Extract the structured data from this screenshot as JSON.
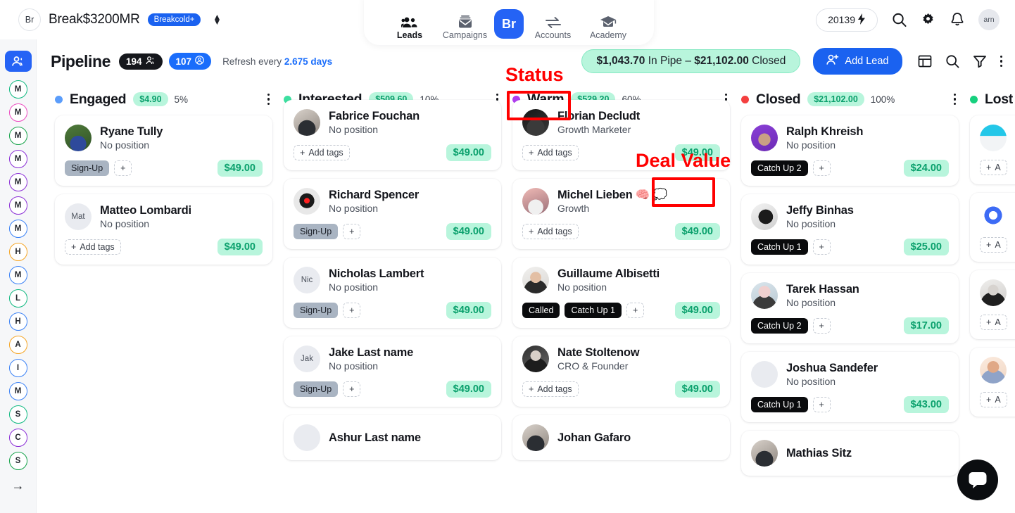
{
  "topbar": {
    "workspace_initials": "Br",
    "workspace_name": "Break$3200MR",
    "plan_badge": "Breakcold+",
    "nav": [
      {
        "label": "Leads",
        "icon": "people-icon",
        "active": true
      },
      {
        "label": "Campaigns",
        "icon": "envelope-icon",
        "active": false
      },
      {
        "label": "",
        "icon": "breakcold-logo",
        "logo_text": "Br",
        "active": false
      },
      {
        "label": "Accounts",
        "icon": "exchange-arrows-icon",
        "active": false
      },
      {
        "label": "Academy",
        "icon": "graduation-cap-icon",
        "active": false
      }
    ],
    "credits": "20139",
    "credits_icon": "lightning-bolt-icon",
    "user_initials": "arn"
  },
  "rail": {
    "top_icon": "people-icon",
    "chips": [
      {
        "letter": "M",
        "color": "#10b981"
      },
      {
        "letter": "M",
        "color": "#ec4bc1"
      },
      {
        "letter": "M",
        "color": "#16a34a"
      },
      {
        "letter": "M",
        "color": "#8b2fd6"
      },
      {
        "letter": "M",
        "color": "#8b2fd6"
      },
      {
        "letter": "M",
        "color": "#8b2fd6"
      },
      {
        "letter": "M",
        "color": "#3b82f6"
      },
      {
        "letter": "H",
        "color": "#f5a524"
      },
      {
        "letter": "M",
        "color": "#3b82f6"
      },
      {
        "letter": "L",
        "color": "#10b981"
      },
      {
        "letter": "H",
        "color": "#3b82f6"
      },
      {
        "letter": "A",
        "color": "#f5a524"
      },
      {
        "letter": "I",
        "color": "#3b82f6"
      },
      {
        "letter": "M",
        "color": "#3b82f6"
      },
      {
        "letter": "S",
        "color": "#10b981"
      },
      {
        "letter": "C",
        "color": "#8b2fd6"
      },
      {
        "letter": "S",
        "color": "#16a34a"
      }
    ],
    "expand_icon": "arrow-right-icon"
  },
  "header": {
    "title": "Pipeline",
    "leads_count": "194",
    "contacts_count": "107",
    "refresh_prefix": "Refresh every",
    "refresh_value": "2.675 days",
    "totals_in_pipe_amount": "$1,043.70",
    "totals_in_pipe_label": "In Pipe",
    "totals_separator": "–",
    "totals_closed_amount": "$21,102.00",
    "totals_closed_label": "Closed",
    "add_lead_label": "Add Lead",
    "icons": [
      "table-view-icon",
      "search-icon",
      "filter-icon",
      "more-options-icon"
    ]
  },
  "annotations": [
    {
      "id": "status-label",
      "text": "Status"
    },
    {
      "id": "deal-value-label",
      "text": "Deal Value"
    }
  ],
  "columns": [
    {
      "name": "Engaged",
      "dot_color": "#5b9dfb",
      "amount": "$4.90",
      "percent": "5%",
      "cards": [
        {
          "name": "Ryane Tully",
          "position": "No position",
          "avatar_initials": "",
          "avatar_kind": "photo-green",
          "tags": [
            {
              "label": "Sign-Up",
              "style": "grey"
            }
          ],
          "add_tag": "+",
          "money": "$49.00"
        },
        {
          "name": "Matteo Lombardi",
          "position": "No position",
          "avatar_initials": "Mat",
          "avatar_kind": "initials",
          "tags": [],
          "add_tag": "Add tags",
          "money": "$49.00"
        }
      ]
    },
    {
      "name": "Interested",
      "dot_color": "#3ddfa0",
      "amount": "$509.60",
      "percent": "10%",
      "cards": [
        {
          "name": "Fabrice Fouchan",
          "position": "No position",
          "avatar_initials": "",
          "avatar_kind": "photo-dark",
          "tags": [],
          "add_tag": "Add tags",
          "money": "$49.00"
        },
        {
          "name": "Richard Spencer",
          "position": "No position",
          "avatar_initials": "",
          "avatar_kind": "photo-hal",
          "tags": [
            {
              "label": "Sign-Up",
              "style": "grey"
            }
          ],
          "add_tag": "+",
          "money": "$49.00"
        },
        {
          "name": "Nicholas Lambert",
          "position": "No position",
          "avatar_initials": "Nic",
          "avatar_kind": "initials",
          "tags": [
            {
              "label": "Sign-Up",
              "style": "grey"
            }
          ],
          "add_tag": "+",
          "money": "$49.00"
        },
        {
          "name": "Jake Last name",
          "position": "No position",
          "avatar_initials": "Jak",
          "avatar_kind": "initials",
          "tags": [
            {
              "label": "Sign-Up",
              "style": "grey"
            }
          ],
          "add_tag": "+",
          "money": "$49.00"
        },
        {
          "name": "Ashur Last name",
          "position": "",
          "avatar_initials": "",
          "avatar_kind": "initials",
          "tags": [],
          "add_tag": "",
          "money": ""
        }
      ]
    },
    {
      "name": "Warm",
      "dot_color": "#b03df0",
      "amount": "$529.20",
      "percent": "60%",
      "highlighted": true,
      "cards": [
        {
          "name": "Florian Decludt",
          "position": "Growth Marketer",
          "avatar_initials": "",
          "avatar_kind": "photo-bw",
          "tags": [],
          "add_tag": "Add tags",
          "money": "$49.00",
          "money_highlighted": true
        },
        {
          "name": "Michel Lieben 🧠 💭",
          "position": "Growth",
          "avatar_initials": "",
          "avatar_kind": "photo-pink",
          "tags": [],
          "add_tag": "Add tags",
          "money": "$49.00"
        },
        {
          "name": "Guillaume Albisetti",
          "position": "No position",
          "avatar_initials": "",
          "avatar_kind": "photo-light",
          "tags": [
            {
              "label": "Called",
              "style": "black"
            },
            {
              "label": "Catch Up 1",
              "style": "black"
            }
          ],
          "add_tag": "+",
          "money": "$49.00"
        },
        {
          "name": "Nate Stoltenow",
          "position": "CRO & Founder",
          "avatar_initials": "",
          "avatar_kind": "photo-bw2",
          "tags": [],
          "add_tag": "Add tags",
          "money": "$49.00"
        },
        {
          "name": "Johan Gafaro",
          "position": "",
          "avatar_initials": "",
          "avatar_kind": "photo-dark",
          "tags": [],
          "add_tag": "",
          "money": ""
        }
      ]
    },
    {
      "name": "Closed",
      "dot_color": "#f43f3f",
      "amount": "$21,102.00",
      "percent": "100%",
      "cards": [
        {
          "name": "Ralph Khreish",
          "position": "No position",
          "avatar_initials": "",
          "avatar_kind": "photo-purple",
          "tags": [
            {
              "label": "Catch Up 2",
              "style": "black"
            }
          ],
          "add_tag": "+",
          "money": "$24.00"
        },
        {
          "name": "Jeffy Binhas",
          "position": "No position",
          "avatar_initials": "",
          "avatar_kind": "photo-ink",
          "tags": [
            {
              "label": "Catch Up 1",
              "style": "black"
            }
          ],
          "add_tag": "+",
          "money": "$25.00"
        },
        {
          "name": "Tarek Hassan",
          "position": "No position",
          "avatar_initials": "",
          "avatar_kind": "photo-pale",
          "tags": [
            {
              "label": "Catch Up 2",
              "style": "black"
            }
          ],
          "add_tag": "+",
          "money": "$17.00"
        },
        {
          "name": "Joshua Sandefer",
          "position": "No position",
          "avatar_initials": "",
          "avatar_kind": "blank",
          "tags": [
            {
              "label": "Catch Up 1",
              "style": "black"
            }
          ],
          "add_tag": "+",
          "money": "$43.00"
        },
        {
          "name": "Mathias Sitz",
          "position": "",
          "avatar_initials": "",
          "avatar_kind": "photo-dark",
          "tags": [],
          "add_tag": "",
          "money": ""
        }
      ]
    },
    {
      "name": "Lost",
      "dot_color": "#16d07e",
      "amount": "",
      "percent": "",
      "cards": [
        {
          "name": "",
          "position": "",
          "avatar_initials": "",
          "avatar_kind": "photo-banner",
          "tags": [],
          "add_tag": "A",
          "money": ""
        },
        {
          "name": "",
          "position": "",
          "avatar_initials": "",
          "avatar_kind": "logo-blue",
          "tags": [],
          "add_tag": "A",
          "money": ""
        },
        {
          "name": "",
          "position": "",
          "avatar_initials": "",
          "avatar_kind": "photo-bw3",
          "tags": [],
          "add_tag": "A",
          "money": ""
        },
        {
          "name": "",
          "position": "",
          "avatar_initials": "",
          "avatar_kind": "photo-warm",
          "tags": [],
          "add_tag": "A",
          "money": ""
        }
      ]
    }
  ],
  "chat": {
    "icon": "chat-bubble-icon"
  }
}
